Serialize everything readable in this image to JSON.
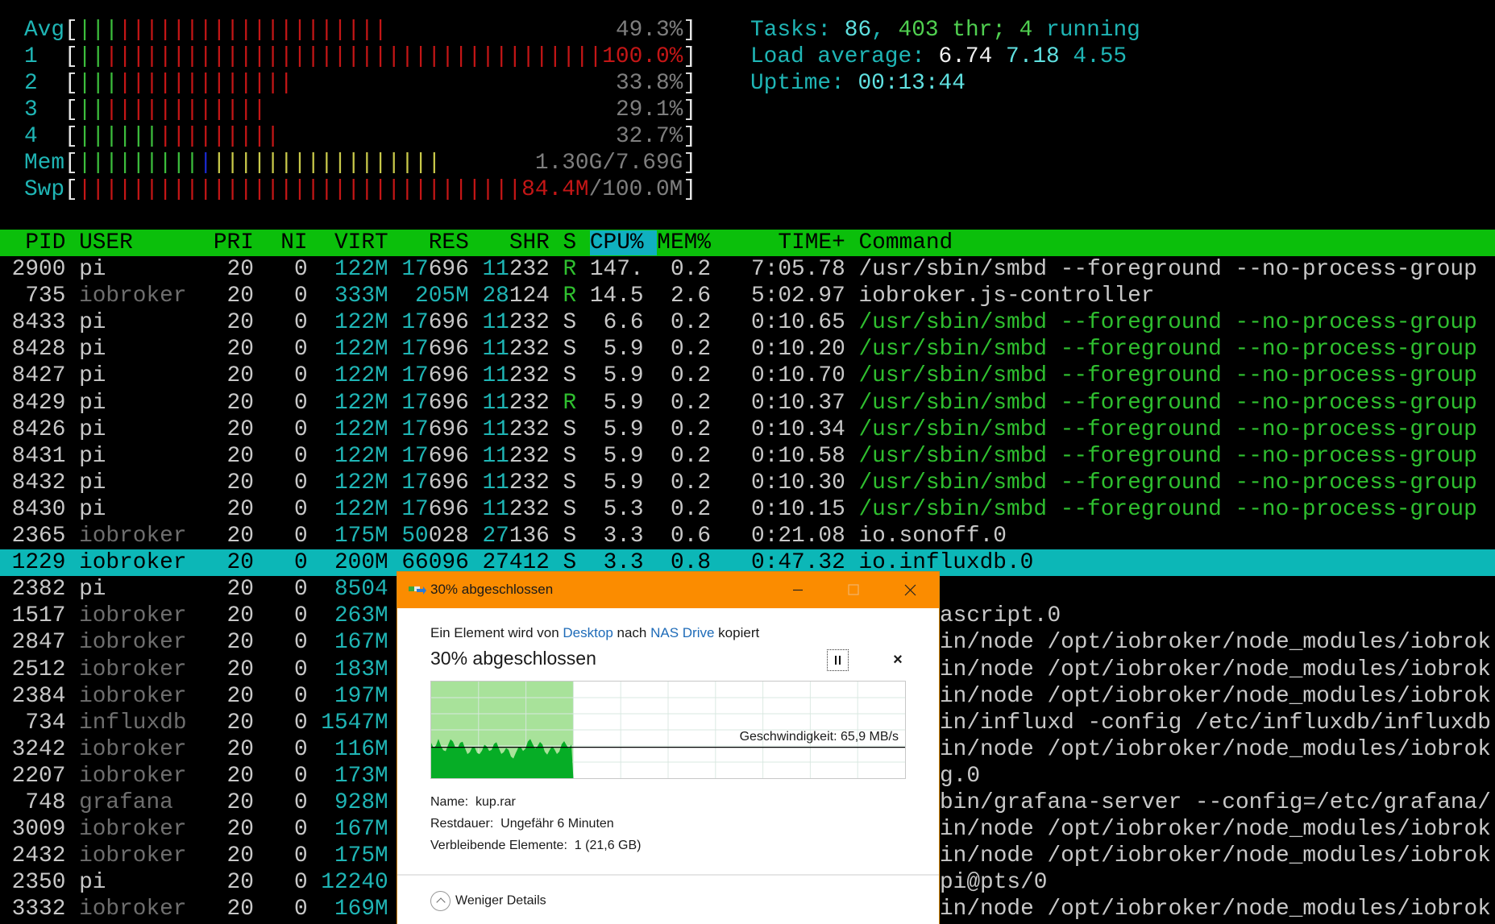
{
  "meters": [
    {
      "label": "Avg",
      "segments": [
        {
          "color": "green",
          "count": 3
        },
        {
          "color": "red",
          "count": 20
        }
      ],
      "value": [
        {
          "text": "49.3%",
          "color": "gray"
        }
      ]
    },
    {
      "label": "1",
      "segments": [
        {
          "color": "green",
          "count": 2
        },
        {
          "color": "red",
          "count": 37
        }
      ],
      "value": [
        {
          "text": "100.0%",
          "color": "red"
        }
      ]
    },
    {
      "label": "2",
      "segments": [
        {
          "color": "green",
          "count": 3
        },
        {
          "color": "red",
          "count": 13
        }
      ],
      "value": [
        {
          "text": "33.8%",
          "color": "gray"
        }
      ]
    },
    {
      "label": "3",
      "segments": [
        {
          "color": "green",
          "count": 2
        },
        {
          "color": "red",
          "count": 12
        }
      ],
      "value": [
        {
          "text": "29.1%",
          "color": "gray"
        }
      ]
    },
    {
      "label": "4",
      "segments": [
        {
          "color": "green",
          "count": 6
        },
        {
          "color": "red",
          "count": 9
        }
      ],
      "value": [
        {
          "text": "32.7%",
          "color": "gray"
        }
      ]
    },
    {
      "label": "Mem",
      "segments": [
        {
          "color": "green",
          "count": 9
        },
        {
          "color": "blue",
          "count": 1
        },
        {
          "color": "yellow",
          "count": 17
        }
      ],
      "value": [
        {
          "text": "1.30G/7.69G",
          "color": "gray"
        }
      ]
    },
    {
      "label": "Swp",
      "segments": [
        {
          "color": "red",
          "count": 33
        }
      ],
      "value": [
        {
          "text": "84.4M",
          "color": "red"
        },
        {
          "text": "/100.0M",
          "color": "gray"
        }
      ]
    }
  ],
  "info": {
    "tasks_label": "Tasks: ",
    "tasks": "86",
    "tasks_sep": ", ",
    "threads": "403",
    "threads_label": " thr; ",
    "running": "4",
    "running_label": " running",
    "load_label": "Load average: ",
    "load1": "6.74",
    "load5": "7.18",
    "load15": "4.55",
    "uptime_label": "Uptime: ",
    "uptime": "00:13:44"
  },
  "header": {
    "pid": "PID",
    "user": "USER",
    "pri": "PRI",
    "ni": "NI",
    "virt": "VIRT",
    "res": "RES",
    "shr": "SHR",
    "s": "S",
    "cpu": "CPU%",
    "mem": "MEM%",
    "time": "TIME+",
    "cmd": "Command"
  },
  "processes": [
    {
      "pid": "2900",
      "user": "pi",
      "pri": "20",
      "ni": "0",
      "virt": "122M",
      "res_hi": "17",
      "res_lo": "696",
      "shr_hi": "11",
      "shr_lo": "232",
      "s": "R",
      "cpu": "147.",
      "mem": "0.2",
      "time": "7:05.78",
      "cmd": "/usr/sbin/smbd --foreground --no-process-group"
    },
    {
      "pid": "735",
      "user": "iobroker",
      "pri": "20",
      "ni": "0",
      "virt": "333M",
      "res_hi": "205M",
      "res_lo": "",
      "shr_hi": "28",
      "shr_lo": "124",
      "s": "R",
      "cpu": "14.5",
      "mem": "2.6",
      "time": "5:02.97",
      "cmd": "iobroker.js-controller"
    },
    {
      "pid": "8433",
      "user": "pi",
      "pri": "20",
      "ni": "0",
      "virt": "122M",
      "res_hi": "17",
      "res_lo": "696",
      "shr_hi": "11",
      "shr_lo": "232",
      "s": "S",
      "cpu": "6.6",
      "mem": "0.2",
      "time": "0:10.65",
      "cmd": "/usr/sbin/smbd --foreground --no-process-group",
      "thread": true
    },
    {
      "pid": "8428",
      "user": "pi",
      "pri": "20",
      "ni": "0",
      "virt": "122M",
      "res_hi": "17",
      "res_lo": "696",
      "shr_hi": "11",
      "shr_lo": "232",
      "s": "S",
      "cpu": "5.9",
      "mem": "0.2",
      "time": "0:10.20",
      "cmd": "/usr/sbin/smbd --foreground --no-process-group",
      "thread": true
    },
    {
      "pid": "8427",
      "user": "pi",
      "pri": "20",
      "ni": "0",
      "virt": "122M",
      "res_hi": "17",
      "res_lo": "696",
      "shr_hi": "11",
      "shr_lo": "232",
      "s": "S",
      "cpu": "5.9",
      "mem": "0.2",
      "time": "0:10.70",
      "cmd": "/usr/sbin/smbd --foreground --no-process-group",
      "thread": true
    },
    {
      "pid": "8429",
      "user": "pi",
      "pri": "20",
      "ni": "0",
      "virt": "122M",
      "res_hi": "17",
      "res_lo": "696",
      "shr_hi": "11",
      "shr_lo": "232",
      "s": "R",
      "cpu": "5.9",
      "mem": "0.2",
      "time": "0:10.37",
      "cmd": "/usr/sbin/smbd --foreground --no-process-group",
      "thread": true
    },
    {
      "pid": "8426",
      "user": "pi",
      "pri": "20",
      "ni": "0",
      "virt": "122M",
      "res_hi": "17",
      "res_lo": "696",
      "shr_hi": "11",
      "shr_lo": "232",
      "s": "S",
      "cpu": "5.9",
      "mem": "0.2",
      "time": "0:10.34",
      "cmd": "/usr/sbin/smbd --foreground --no-process-group",
      "thread": true
    },
    {
      "pid": "8431",
      "user": "pi",
      "pri": "20",
      "ni": "0",
      "virt": "122M",
      "res_hi": "17",
      "res_lo": "696",
      "shr_hi": "11",
      "shr_lo": "232",
      "s": "S",
      "cpu": "5.9",
      "mem": "0.2",
      "time": "0:10.58",
      "cmd": "/usr/sbin/smbd --foreground --no-process-group",
      "thread": true
    },
    {
      "pid": "8432",
      "user": "pi",
      "pri": "20",
      "ni": "0",
      "virt": "122M",
      "res_hi": "17",
      "res_lo": "696",
      "shr_hi": "11",
      "shr_lo": "232",
      "s": "S",
      "cpu": "5.9",
      "mem": "0.2",
      "time": "0:10.30",
      "cmd": "/usr/sbin/smbd --foreground --no-process-group",
      "thread": true
    },
    {
      "pid": "8430",
      "user": "pi",
      "pri": "20",
      "ni": "0",
      "virt": "122M",
      "res_hi": "17",
      "res_lo": "696",
      "shr_hi": "11",
      "shr_lo": "232",
      "s": "S",
      "cpu": "5.3",
      "mem": "0.2",
      "time": "0:10.15",
      "cmd": "/usr/sbin/smbd --foreground --no-process-group",
      "thread": true
    },
    {
      "pid": "2365",
      "user": "iobroker",
      "pri": "20",
      "ni": "0",
      "virt": "175M",
      "res_hi": "50",
      "res_lo": "028",
      "shr_hi": "27",
      "shr_lo": "136",
      "s": "S",
      "cpu": "3.3",
      "mem": "0.6",
      "time": "0:21.08",
      "cmd": "io.sonoff.0"
    },
    {
      "pid": "1229",
      "user": "iobroker",
      "pri": "20",
      "ni": "0",
      "virt": "200M",
      "res_hi": "",
      "res_lo": "66096",
      "shr_hi": "",
      "shr_lo": "27412",
      "s": "S",
      "cpu": "3.3",
      "mem": "0.8",
      "time": "0:47.32",
      "cmd": "io.influxdb.0",
      "selected": true
    }
  ],
  "processes_partial": [
    {
      "pid": "2382",
      "user": "pi",
      "pri": "20",
      "ni": "0",
      "virt": "8504",
      "cmd_visible": ""
    },
    {
      "pid": "1517",
      "user": "iobroker",
      "pri": "20",
      "ni": "0",
      "virt": "263M",
      "cmd_visible": "ascript.0"
    },
    {
      "pid": "2847",
      "user": "iobroker",
      "pri": "20",
      "ni": "0",
      "virt": "167M",
      "cmd_visible": "in/node /opt/iobroker/node_modules/iobrok"
    },
    {
      "pid": "2512",
      "user": "iobroker",
      "pri": "20",
      "ni": "0",
      "virt": "183M",
      "cmd_visible": "in/node /opt/iobroker/node_modules/iobrok"
    },
    {
      "pid": "2384",
      "user": "iobroker",
      "pri": "20",
      "ni": "0",
      "virt": "197M",
      "cmd_visible": "in/node /opt/iobroker/node_modules/iobrok"
    },
    {
      "pid": "734",
      "user": "influxdb",
      "pri": "20",
      "ni": "0",
      "virt": "1547M",
      "cmd_visible": "in/influxd -config /etc/influxdb/influxdb"
    },
    {
      "pid": "3242",
      "user": "iobroker",
      "pri": "20",
      "ni": "0",
      "virt": "116M",
      "cmd_visible": "in/node /opt/iobroker/node_modules/iobrok"
    },
    {
      "pid": "2207",
      "user": "iobroker",
      "pri": "20",
      "ni": "0",
      "virt": "173M",
      "cmd_visible": "g.0"
    },
    {
      "pid": "748",
      "user": "grafana",
      "pri": "20",
      "ni": "0",
      "virt": "928M",
      "cmd_visible": "bin/grafana-server --config=/etc/grafana/"
    },
    {
      "pid": "3009",
      "user": "iobroker",
      "pri": "20",
      "ni": "0",
      "virt": "167M",
      "cmd_visible": "in/node /opt/iobroker/node_modules/iobrok"
    },
    {
      "pid": "2432",
      "user": "iobroker",
      "pri": "20",
      "ni": "0",
      "virt": "175M",
      "cmd_visible": "in/node /opt/iobroker/node_modules/iobrok"
    },
    {
      "pid": "2350",
      "user": "pi",
      "pri": "20",
      "ni": "0",
      "virt": "12240",
      "cmd_visible": "pi@pts/0"
    },
    {
      "pid": "3332",
      "user": "iobroker",
      "pri": "20",
      "ni": "0",
      "virt": "169M",
      "cmd_visible": "in/node /opt/iobroker/node_modules/iobrok"
    }
  ],
  "dialog": {
    "title": "30% abgeschlossen",
    "msg_pre": "Ein Element wird von ",
    "source": "Desktop",
    "msg_mid": " nach ",
    "dest": "NAS Drive",
    "msg_post": " kopiert",
    "heading": "30% abgeschlossen",
    "progress_percent": 30,
    "speed": "Geschwindigkeit: 65,9 MB/s",
    "name_label": "Name:",
    "name": "kup.rar",
    "remaining_label": "Restdauer:",
    "remaining": "Ungefähr 6 Minuten",
    "items_label": "Verbleibende Elemente:",
    "items": "1 (21,6 GB)",
    "less_details": "Weniger Details",
    "colors": {
      "titlebar": "#fb8c00",
      "progress_light": "#a8e29a",
      "progress_dark": "#06ad26"
    }
  },
  "colors": {
    "header_bg": "#0bbf0b",
    "selected_bg": "#0cb7b7",
    "cyan": "#1fb5b5"
  }
}
